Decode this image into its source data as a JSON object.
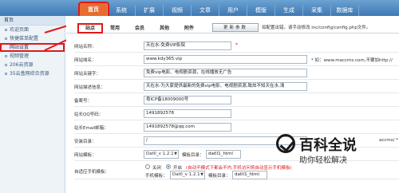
{
  "nav": {
    "tabs": [
      {
        "label": "首页",
        "active": true
      },
      {
        "label": "系统"
      },
      {
        "label": "扩展"
      },
      {
        "label": "视频"
      },
      {
        "label": "文章"
      },
      {
        "label": "用户"
      },
      {
        "label": "模版"
      },
      {
        "label": "生成"
      },
      {
        "label": "采集"
      },
      {
        "label": "数据库"
      }
    ]
  },
  "sidebar": {
    "header": "首页",
    "items": [
      {
        "label": "欢迎页面"
      },
      {
        "label": "快捷菜单配置"
      },
      {
        "label": "网站设置",
        "active": true
      },
      {
        "label": "视频管理"
      },
      {
        "label": "206云资源"
      },
      {
        "label": "35云盒网综合资源"
      }
    ]
  },
  "settings": {
    "subtabs": [
      "站点",
      "常用",
      "会员",
      "其他",
      "附件"
    ],
    "clean_button": "更新参数",
    "hint": "如配置出错，请手动修改 inc/config/config.php文件。",
    "rows": {
      "site_name": {
        "label": "网站名称：",
        "value": "天在水-免费VIP影院"
      },
      "domain": {
        "label": "网站域名：",
        "value": "www.kdy365.vip",
        "note": "* 如：www.maccms.com,不要加http://"
      },
      "keywords": {
        "label": "网站关键字：",
        "value": "免费vip电影、电视剧资源，在线播放无广告"
      },
      "description": {
        "label": "网站描述信息：",
        "value": "天在水-为大家提供最新的免费vip电影、电视剧资源,致炫不知天在水,淸"
      },
      "icp": {
        "label": "备案号：",
        "value": "粤ICP备18009000号"
      },
      "qq": {
        "label": "站长QQ号码：",
        "value": "1491892578"
      },
      "email": {
        "label": "站长Email邮箱：",
        "value": "1491892578@qq.com"
      },
      "install_dir": {
        "label": "安装目录：",
        "value": "/",
        "note": "accms/ *"
      },
      "template": {
        "label": "网站模板：",
        "select": "Datll_v 1.2.1",
        "dir_label": "模板目录：",
        "dir_value": "datll1_html"
      },
      "mobile": {
        "label": "自适应手机模板：",
        "off_label": "关闭",
        "on_label": "开启",
        "warn": "(自动不模式下都会不内,手机访问将自动显示手机模板)",
        "template_label": "手机模板：",
        "select": "Datll_v 1.2.1",
        "dir_label": "模板目录：",
        "dir_value": "datll1_html"
      }
    }
  },
  "watermark": {
    "title": "百科全说",
    "subtitle": "助你轻松解决"
  },
  "colors": {
    "accent": "#e86b2f",
    "annotation": "#e0191b",
    "nav_bg": "#3f78b3"
  }
}
